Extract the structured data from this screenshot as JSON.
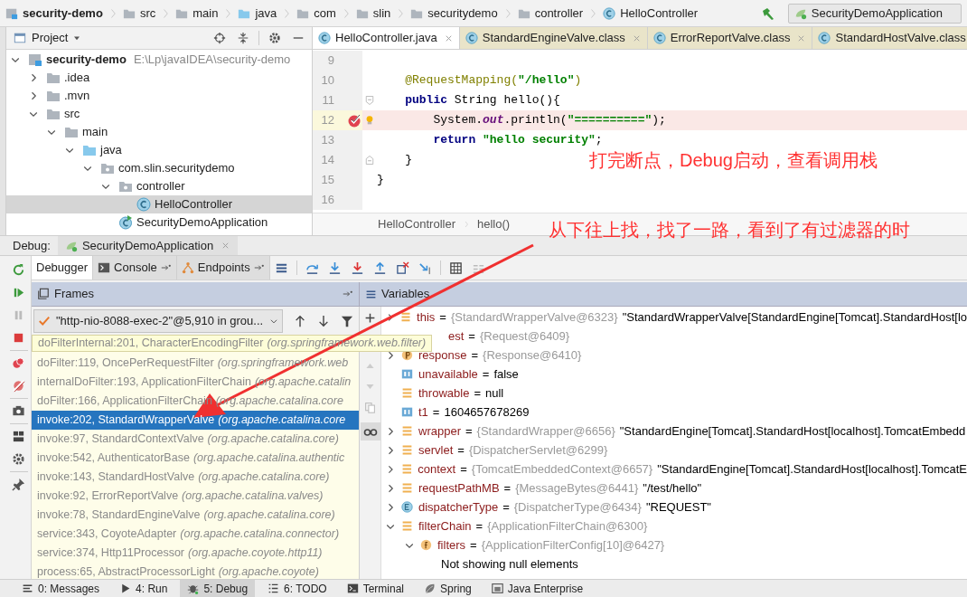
{
  "nav_bar": {
    "crumbs": [
      {
        "label": "security-demo",
        "kind": "module"
      },
      {
        "label": "src",
        "kind": "folder"
      },
      {
        "label": "main",
        "kind": "folder"
      },
      {
        "label": "java",
        "kind": "source_folder"
      },
      {
        "label": "com",
        "kind": "folder"
      },
      {
        "label": "slin",
        "kind": "folder"
      },
      {
        "label": "securitydemo",
        "kind": "folder"
      },
      {
        "label": "controller",
        "kind": "folder"
      },
      {
        "label": "HelloController",
        "kind": "class"
      }
    ],
    "run_config": "SecurityDemoApplication"
  },
  "project": {
    "title": "Project",
    "tree": [
      {
        "label": "security-demo",
        "path": "E:\\Lp\\javaIDEA\\security-demo",
        "kind": "module",
        "expanded": true,
        "selected": false,
        "children": [
          {
            "label": ".idea",
            "kind": "folder",
            "expanded": false,
            "selected": false
          },
          {
            "label": ".mvn",
            "kind": "folder",
            "expanded": false,
            "selected": false
          },
          {
            "label": "src",
            "kind": "folder",
            "expanded": true,
            "selected": false,
            "children": [
              {
                "label": "main",
                "kind": "folder",
                "expanded": true,
                "selected": false,
                "children": [
                  {
                    "label": "java",
                    "kind": "source_folder",
                    "expanded": true,
                    "selected": false,
                    "children": [
                      {
                        "label": "com.slin.securitydemo",
                        "kind": "package",
                        "expanded": true,
                        "selected": false,
                        "children": [
                          {
                            "label": "controller",
                            "kind": "package",
                            "expanded": true,
                            "selected": false,
                            "children": [
                              {
                                "label": "HelloController",
                                "kind": "class",
                                "selected": true
                              }
                            ]
                          },
                          {
                            "label": "SecurityDemoApplication",
                            "kind": "app_class",
                            "selected": false
                          }
                        ]
                      }
                    ]
                  }
                ]
              }
            ]
          }
        ]
      }
    ]
  },
  "editor": {
    "tabs": [
      {
        "label": "HelloController.java",
        "selected": true
      },
      {
        "label": "StandardEngineValve.class",
        "selected": false
      },
      {
        "label": "ErrorReportValve.class",
        "selected": false
      },
      {
        "label": "StandardHostValve.class",
        "selected": false
      }
    ],
    "lines": [
      {
        "number": "9",
        "kind": "plain",
        "breakpoint": false
      },
      {
        "number": "10",
        "kind": "plain",
        "breakpoint": false,
        "tokens": [
          {
            "text": "    @RequestMapping(",
            "kind": "annotation"
          },
          {
            "text": "\"/hello\"",
            "kind": "string"
          },
          {
            "text": ")",
            "kind": "annotation"
          }
        ]
      },
      {
        "number": "11",
        "kind": "fold_start",
        "breakpoint": false,
        "tokens": [
          {
            "text": "    public",
            "kind": "keyword"
          },
          {
            "text": " String hello(){",
            "kind": "plain"
          }
        ]
      },
      {
        "number": "12",
        "kind": "plain",
        "breakpoint": true,
        "tokens": [
          {
            "text": "        System.",
            "kind": "plain"
          },
          {
            "text": "out",
            "kind": "static"
          },
          {
            "text": ".println(",
            "kind": "plain"
          },
          {
            "text": "\"==========\"",
            "kind": "string"
          },
          {
            "text": ");",
            "kind": "plain"
          }
        ]
      },
      {
        "number": "13",
        "kind": "plain",
        "breakpoint": false,
        "tokens": [
          {
            "text": "        return",
            "kind": "keyword"
          },
          {
            "text": " \"hello security\"",
            "kind": "string"
          },
          {
            "text": ";",
            "kind": "plain"
          }
        ]
      },
      {
        "number": "14",
        "kind": "fold_end",
        "breakpoint": false,
        "tokens": [
          {
            "text": "    }",
            "kind": "plain"
          }
        ]
      },
      {
        "number": "15",
        "kind": "plain",
        "breakpoint": false,
        "tokens": [
          {
            "text": "}",
            "kind": "plain"
          }
        ]
      },
      {
        "number": "16",
        "kind": "plain",
        "breakpoint": false
      }
    ],
    "breadcrumb": [
      "HelloController",
      "hello()"
    ]
  },
  "debug": {
    "label": "Debug:",
    "session": "SecurityDemoApplication",
    "tabs": [
      {
        "label": "Debugger",
        "kind": "debugger",
        "selected": true
      },
      {
        "label": "Console",
        "kind": "console",
        "selected": false
      },
      {
        "label": "Endpoints",
        "kind": "endpoints",
        "selected": false
      }
    ],
    "frames_title": "Frames",
    "variables_title": "Variables",
    "thread": "\"http-nio-8088-exec-2\"@5,910 in grou...",
    "frames": [
      {
        "kind": "tooltip",
        "method": "doFilterInternal:201, CharacterEncodingFilter",
        "package": "(org.springframework.web.filter)",
        "selected": false
      },
      {
        "kind": "frame",
        "method": "doFilter:119, OncePerRequestFilter",
        "package": "(org.springframework.web",
        "selected": false
      },
      {
        "kind": "frame",
        "method": "internalDoFilter:193, ApplicationFilterChain",
        "package": "(org.apache.catalin",
        "selected": false
      },
      {
        "kind": "frame",
        "method": "doFilter:166, ApplicationFilterChain",
        "package": "(org.apache.catalina.core",
        "selected": false
      },
      {
        "kind": "frame",
        "method": "invoke:202, StandardWrapperValve",
        "package": "(org.apache.catalina.core",
        "selected": true
      },
      {
        "kind": "frame",
        "method": "invoke:97, StandardContextValve",
        "package": "(org.apache.catalina.core)",
        "selected": false
      },
      {
        "kind": "frame",
        "method": "invoke:542, AuthenticatorBase",
        "package": "(org.apache.catalina.authentic",
        "selected": false
      },
      {
        "kind": "frame",
        "method": "invoke:143, StandardHostValve",
        "package": "(org.apache.catalina.core)",
        "selected": false
      },
      {
        "kind": "frame",
        "method": "invoke:92, ErrorReportValve",
        "package": "(org.apache.catalina.valves)",
        "selected": false
      },
      {
        "kind": "frame",
        "method": "invoke:78, StandardEngineValve",
        "package": "(org.apache.catalina.core)",
        "selected": false
      },
      {
        "kind": "frame",
        "method": "service:343, CoyoteAdapter",
        "package": "(org.apache.catalina.connector)",
        "selected": false
      },
      {
        "kind": "frame",
        "method": "service:374, Http11Processor",
        "package": "(org.apache.coyote.http11)",
        "selected": false
      },
      {
        "kind": "frame",
        "method": "process:65, AbstractProcessorLight",
        "package": "(org.apache.coyote)",
        "selected": false
      }
    ],
    "variables": [
      {
        "kind": "field",
        "name": "this",
        "sign": "=",
        "type": "{StandardWrapperValve@6323}",
        "value": "\"StandardWrapperValve[StandardEngine[Tomcat].StandardHost[lo",
        "expanded": false
      },
      {
        "kind": "partly_hidden",
        "name": "est",
        "sign": "=",
        "type": "{Request@6409}"
      },
      {
        "kind": "param",
        "name": "response",
        "sign": "=",
        "type": "{Response@6410}",
        "expanded": false
      },
      {
        "kind": "primitive",
        "name": "unavailable",
        "sign": "=",
        "value": "false"
      },
      {
        "kind": "field",
        "name": "throwable",
        "sign": "=",
        "value": "null"
      },
      {
        "kind": "primitive",
        "name": "t1",
        "sign": "=",
        "value": "1604657678269"
      },
      {
        "kind": "field",
        "name": "wrapper",
        "sign": "=",
        "type": "{StandardWrapper@6656}",
        "value": "\"StandardEngine[Tomcat].StandardHost[localhost].TomcatEmbedd",
        "expanded": false
      },
      {
        "kind": "field",
        "name": "servlet",
        "sign": "=",
        "type": "{DispatcherServlet@6299}",
        "expanded": false
      },
      {
        "kind": "field",
        "name": "context",
        "sign": "=",
        "type": "{TomcatEmbeddedContext@6657}",
        "value": "\"StandardEngine[Tomcat].StandardHost[localhost].TomcatE",
        "expanded": false
      },
      {
        "kind": "field",
        "name": "requestPathMB",
        "sign": "=",
        "type": "{MessageBytes@6441}",
        "value": "\"/test/hello\"",
        "expanded": false
      },
      {
        "kind": "enum",
        "name": "dispatcherType",
        "sign": "=",
        "type": "{DispatcherType@6434}",
        "value": "\"REQUEST\"",
        "expanded": false
      },
      {
        "kind": "field",
        "name": "filterChain",
        "sign": "=",
        "type": "{ApplicationFilterChain@6300}",
        "expanded": true,
        "children": [
          {
            "kind": "final",
            "name": "filters",
            "sign": "=",
            "type": "{ApplicationFilterConfig[10]@6427}",
            "expanded": true,
            "children": [
              {
                "kind": "note",
                "name": "Not showing null elements"
              }
            ]
          }
        ]
      }
    ]
  },
  "bottom_bar": [
    {
      "label": "0: Messages",
      "kind": "messages",
      "selected": false
    },
    {
      "label": "4: Run",
      "kind": "run",
      "selected": false
    },
    {
      "label": "5: Debug",
      "kind": "debug",
      "selected": true
    },
    {
      "label": "6: TODO",
      "kind": "todo",
      "selected": false
    },
    {
      "label": "Terminal",
      "kind": "terminal",
      "selected": false
    },
    {
      "label": "Spring",
      "kind": "spring",
      "selected": false
    },
    {
      "label": "Java Enterprise",
      "kind": "javaee",
      "selected": false
    }
  ],
  "annotations": [
    {
      "text": "打完断点，Debug启动，查看调用栈"
    },
    {
      "text": "从下往上找，找了一路，看到了有过滤器的时"
    }
  ]
}
